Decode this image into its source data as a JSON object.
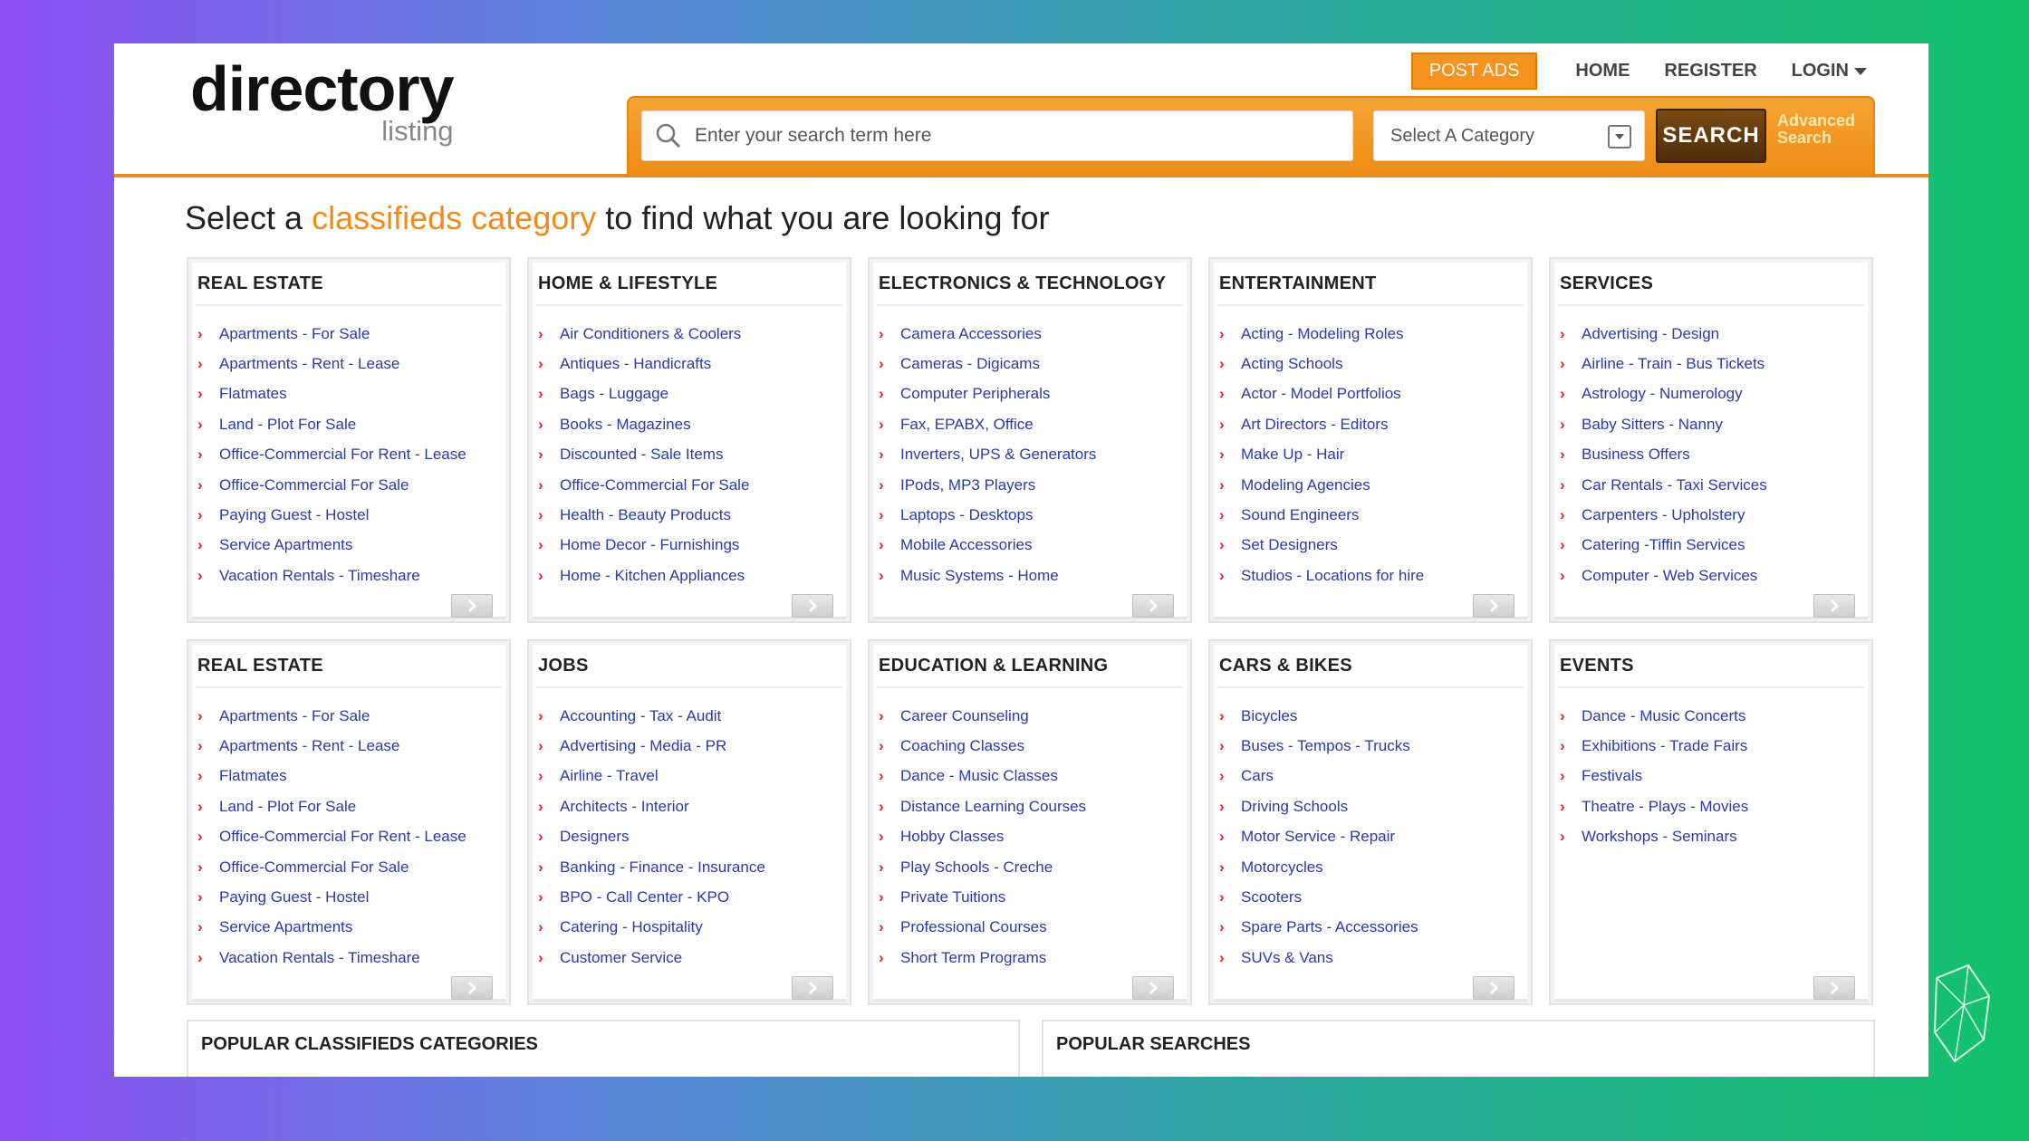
{
  "logo": {
    "main": "directory",
    "sub": "listing"
  },
  "topnav": {
    "post_ads": "POST ADS",
    "home": "HOME",
    "register": "REGISTER",
    "login": "LOGIN"
  },
  "search": {
    "placeholder": "Enter your search term here",
    "category_selected": "Select A Category",
    "button": "SEARCH",
    "advanced_line1": "Advanced",
    "advanced_line2": "Search"
  },
  "heading": {
    "pre": "Select a ",
    "accent": "classifieds category",
    "post": " to find what you are looking for"
  },
  "colors": {
    "accent": "#f08a1c",
    "link": "#2a3aa8",
    "bullet": "#e0202a",
    "search_button": "#5a340b"
  },
  "categories": [
    {
      "title": "REAL ESTATE",
      "items": [
        "Apartments - For Sale",
        "Apartments - Rent - Lease",
        "Flatmates",
        "Land - Plot For Sale",
        "Office-Commercial For Rent - Lease",
        "Office-Commercial For Sale",
        "Paying Guest - Hostel",
        "Service Apartments",
        "Vacation Rentals - Timeshare"
      ]
    },
    {
      "title": "HOME & LIFESTYLE",
      "items": [
        "Air Conditioners & Coolers",
        "Antiques - Handicrafts",
        "Bags - Luggage",
        "Books - Magazines",
        "Discounted - Sale Items",
        "Office-Commercial For Sale",
        "Health - Beauty Products",
        "Home Decor - Furnishings",
        "Home - Kitchen Appliances"
      ]
    },
    {
      "title": "ELECTRONICS & TECHNOLOGY",
      "items": [
        "Camera Accessories",
        "Cameras - Digicams",
        "Computer Peripherals",
        "Fax, EPABX, Office",
        "Inverters, UPS & Generators",
        "IPods, MP3 Players",
        "Laptops - Desktops",
        "Mobile Accessories",
        "Music Systems - Home"
      ]
    },
    {
      "title": "ENTERTAINMENT",
      "items": [
        "Acting - Modeling Roles",
        "Acting Schools",
        "Actor - Model Portfolios",
        "Art Directors - Editors",
        "Make Up - Hair",
        "Modeling Agencies",
        "Sound Engineers",
        "Set Designers",
        "Studios - Locations for hire"
      ]
    },
    {
      "title": "SERVICES",
      "items": [
        "Advertising - Design",
        "Airline - Train - Bus Tickets",
        "Astrology - Numerology",
        "Baby Sitters - Nanny",
        "Business Offers",
        "Car Rentals - Taxi Services",
        "Carpenters - Upholstery",
        "Catering -Tiffin Services",
        "Computer - Web Services"
      ]
    },
    {
      "title": "REAL ESTATE",
      "items": [
        "Apartments - For Sale",
        "Apartments - Rent - Lease",
        "Flatmates",
        "Land - Plot For Sale",
        "Office-Commercial For Rent - Lease",
        "Office-Commercial For Sale",
        "Paying Guest - Hostel",
        "Service Apartments",
        "Vacation Rentals - Timeshare"
      ]
    },
    {
      "title": "JOBS",
      "items": [
        "Accounting - Tax - Audit",
        "Advertising - Media - PR",
        "Airline - Travel",
        "Architects - Interior",
        "Designers",
        "Banking - Finance - Insurance",
        "BPO - Call Center - KPO",
        "Catering - Hospitality",
        "Customer Service"
      ]
    },
    {
      "title": "EDUCATION & LEARNING",
      "items": [
        "Career Counseling",
        "Coaching Classes",
        "Dance - Music Classes",
        "Distance Learning Courses",
        "Hobby Classes",
        "Play Schools - Creche",
        "Private Tuitions",
        "Professional Courses",
        "Short Term Programs"
      ]
    },
    {
      "title": "CARS & BIKES",
      "items": [
        "Bicycles",
        "Buses - Tempos - Trucks",
        "Cars",
        "Driving Schools",
        "Motor Service - Repair",
        "Motorcycles",
        "Scooters",
        "Spare Parts - Accessories",
        "SUVs & Vans"
      ]
    },
    {
      "title": "EVENTS",
      "items": [
        "Dance - Music Concerts",
        "Exhibitions - Trade Fairs",
        "Festivals",
        "Theatre - Plays - Movies",
        "Workshops - Seminars"
      ]
    }
  ],
  "popular": {
    "categories_title": "POPULAR CLASSIFIEDS CATEGORIES",
    "searches_title": "POPULAR SEARCHES"
  },
  "icons": {
    "search": "magnifier-icon",
    "more": "chevron-right-icon",
    "dropdown": "chevron-down-icon"
  }
}
